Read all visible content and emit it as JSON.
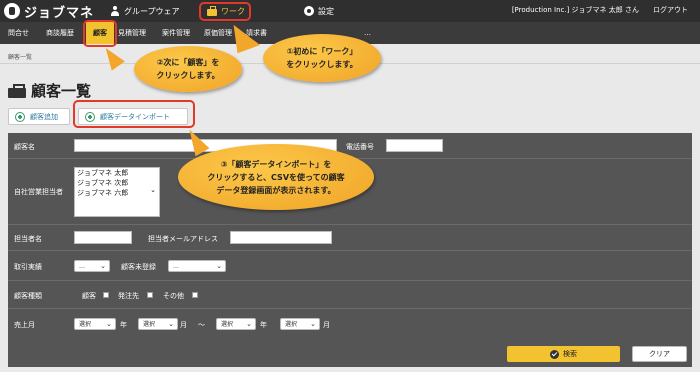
{
  "topbar": {
    "app_title": "ジョブマネ",
    "nav": [
      {
        "label": "グループウェア",
        "icon": "user-icon"
      },
      {
        "label": "ワーク",
        "icon": "briefcase-icon"
      },
      {
        "label": "設定",
        "icon": "gear-icon"
      }
    ],
    "user": "[Production Inc.] ジョブマネ 太郎 さん",
    "logout": "ログアウト"
  },
  "subnav": {
    "items": [
      "問合せ",
      "商談履歴",
      "顧客",
      "見積管理",
      "案件管理",
      "原価管理",
      "請求書",
      "…"
    ],
    "active": "顧客"
  },
  "breadcrumb": "顧客一覧",
  "page": {
    "title": "顧客一覧",
    "add_button": "顧客追加",
    "import_button": "顧客データインポート"
  },
  "search_form": {
    "customer_name_label": "顧客名",
    "phone_label": "電話番号",
    "sales_rep_label": "自社営業担当者",
    "sales_rep_options": [
      "ジョブマネ 太郎",
      "ジョブマネ 次郎",
      "ジョブマネ 六郎"
    ],
    "contact_label": "担当者名",
    "contact_email_label": "担当者メールアドレス",
    "trade_record_label": "取引実績",
    "trade_record_value": "…",
    "unregistered_label": "顧客未登録",
    "unregistered_value": "…",
    "customer_type_label": "顧客種類",
    "customer_type_options": [
      "顧客",
      "発注先",
      "その他"
    ],
    "sales_month_label": "売上月",
    "select_placeholder": "選択",
    "year_unit": "年",
    "month_unit": "月",
    "range_sep": "～",
    "search_button": "検索",
    "clear_button": "クリア"
  },
  "annotations": {
    "step1": [
      "①初めに「ワーク」",
      "をクリックします。"
    ],
    "step2": [
      "②次に「顧客」を",
      "クリックします。"
    ],
    "step3": [
      "③「顧客データインポート」を",
      "クリックすると、CSVを使っての顧客",
      "データ登録画面が表示されます。"
    ]
  },
  "colors": {
    "topbar": "#2f2f2f",
    "accent_yellow": "#f2c230",
    "callout_orange": "#f0a326",
    "highlight_red": "#e23a2a",
    "panel_gray": "#555555"
  }
}
